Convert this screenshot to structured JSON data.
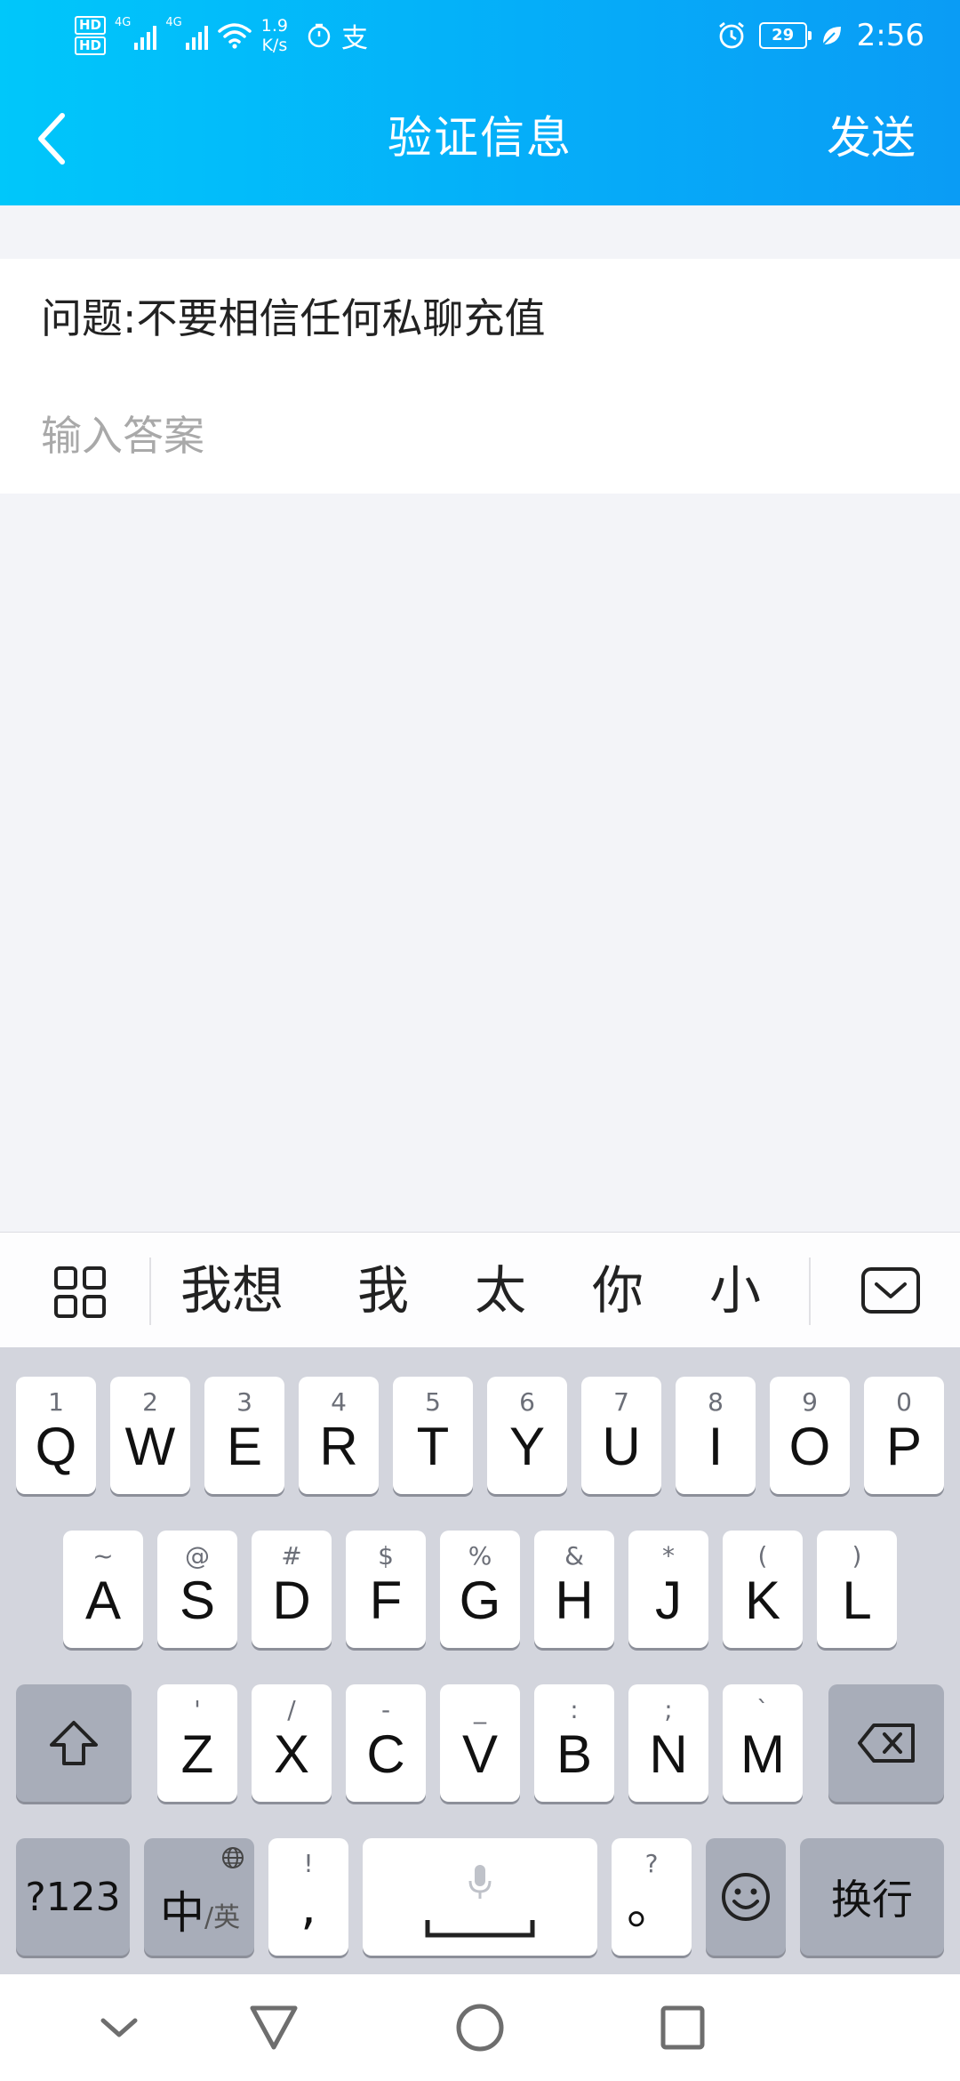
{
  "status_bar": {
    "hd_1": "HD",
    "hd_2": "HD",
    "net_1": "4G",
    "net_2": "4G",
    "speed_value": "1.9",
    "speed_unit": "K/s",
    "app_glyph": "支",
    "battery_level": "29",
    "time": "2:56",
    "icons": [
      "signal-icon",
      "wifi-icon",
      "timer-icon",
      "alarm-icon",
      "battery-icon",
      "leaf-icon"
    ]
  },
  "header": {
    "title": "验证信息",
    "send_label": "发送",
    "back_icon": "chevron-left-icon"
  },
  "form": {
    "question": "问题:不要相信任何私聊充值",
    "answer_value": "",
    "answer_placeholder": "输入答案"
  },
  "candidate_bar": {
    "candidates": [
      "我想",
      "我",
      "太",
      "你",
      "小"
    ],
    "grid_icon": "grid-icon",
    "hide_icon": "keyboard-hide-icon"
  },
  "keyboard": {
    "row1": [
      {
        "num": "1",
        "letter": "Q"
      },
      {
        "num": "2",
        "letter": "W"
      },
      {
        "num": "3",
        "letter": "E"
      },
      {
        "num": "4",
        "letter": "R"
      },
      {
        "num": "5",
        "letter": "T"
      },
      {
        "num": "6",
        "letter": "Y"
      },
      {
        "num": "7",
        "letter": "U"
      },
      {
        "num": "8",
        "letter": "I"
      },
      {
        "num": "9",
        "letter": "O"
      },
      {
        "num": "0",
        "letter": "P"
      }
    ],
    "row2": [
      {
        "num": "~",
        "letter": "A"
      },
      {
        "num": "@",
        "letter": "S"
      },
      {
        "num": "#",
        "letter": "D"
      },
      {
        "num": "$",
        "letter": "F"
      },
      {
        "num": "%",
        "letter": "G"
      },
      {
        "num": "&",
        "letter": "H"
      },
      {
        "num": "*",
        "letter": "J"
      },
      {
        "num": "(",
        "letter": "K"
      },
      {
        "num": ")",
        "letter": "L"
      }
    ],
    "row3": [
      {
        "num": "'",
        "letter": "Z"
      },
      {
        "num": "/",
        "letter": "X"
      },
      {
        "num": "-",
        "letter": "C"
      },
      {
        "num": "_",
        "letter": "V"
      },
      {
        "num": ":",
        "letter": "B"
      },
      {
        "num": ";",
        "letter": "N"
      },
      {
        "num": "`",
        "letter": "M"
      }
    ],
    "sym_label": "?123",
    "lang_main": "中",
    "lang_sub": "/英",
    "comma_top": "!",
    "comma_main": ",",
    "period_top": "?",
    "period_main": "。",
    "enter_label": "换行",
    "icons": [
      "shift-icon",
      "backspace-icon",
      "globe-icon",
      "mic-icon",
      "emoji-icon"
    ]
  },
  "system_nav": {
    "icons": [
      "collapse-icon",
      "back-triangle-icon",
      "home-circle-icon",
      "recents-square-icon"
    ]
  }
}
